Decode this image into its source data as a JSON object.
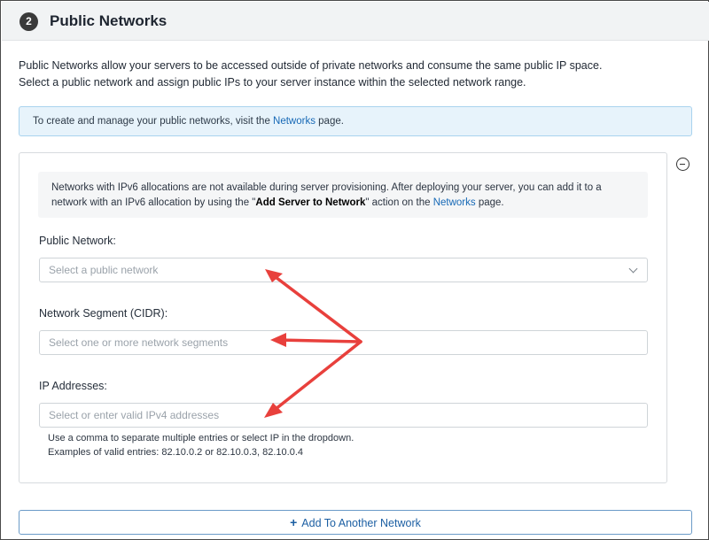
{
  "header": {
    "step_number": "2",
    "title": "Public Networks"
  },
  "description": {
    "line1": "Public Networks allow your servers to be accessed outside of private networks and consume the same public IP space.",
    "line2": "Select a public network and assign public IPs to your server instance within the selected network range."
  },
  "info_bar": {
    "prefix": "To create and manage your public networks, visit the ",
    "link": "Networks",
    "suffix": " page."
  },
  "notice": {
    "line1": "Networks with IPv6 allocations are not available during server provisioning. After deploying your server, you can add it to a",
    "line2_prefix": "network with an IPv6 allocation by using the \"",
    "line2_bold": "Add Server to Network",
    "line2_mid": "\" action on the ",
    "line2_link": "Networks",
    "line2_suffix": " page."
  },
  "fields": {
    "public_network": {
      "label": "Public Network:",
      "placeholder": "Select a public network"
    },
    "network_segment": {
      "label": "Network Segment (CIDR):",
      "placeholder": "Select one or more network segments"
    },
    "ip_addresses": {
      "label": "IP Addresses:",
      "placeholder": "Select or enter valid IPv4 addresses"
    }
  },
  "help": {
    "line1": "Use a comma to separate multiple entries or select IP in the dropdown.",
    "line2": "Examples of valid entries: 82.10.0.2 or 82.10.0.3, 82.10.0.4"
  },
  "add_button": {
    "icon": "plus-icon",
    "label": "Add To Another Network"
  },
  "annotation": {
    "arrow_color": "#e8403c"
  }
}
